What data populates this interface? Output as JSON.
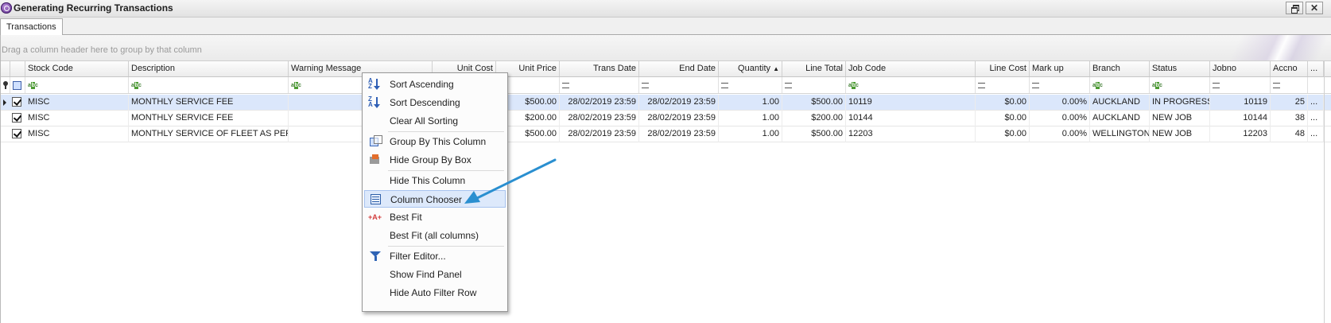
{
  "window": {
    "title": "Generating Recurring Transactions",
    "close_glyph": "✕"
  },
  "tabs": [
    {
      "label": "Transactions"
    }
  ],
  "grid": {
    "group_hint": "Drag a column header here to group by that column",
    "columns": [
      {
        "label": "Stock Code"
      },
      {
        "label": "Description"
      },
      {
        "label": "Warning Message"
      },
      {
        "label": "Unit Cost"
      },
      {
        "label": "Unit Price"
      },
      {
        "label": "Trans Date"
      },
      {
        "label": "End Date"
      },
      {
        "label": "Quantity",
        "sort": "ascending",
        "sort_glyph": "▲"
      },
      {
        "label": "Line Total"
      },
      {
        "label": "Job Code"
      },
      {
        "label": "Line Cost"
      },
      {
        "label": "Mark up"
      },
      {
        "label": "Branch"
      },
      {
        "label": "Status"
      },
      {
        "label": "Jobno"
      },
      {
        "label": "Accno"
      },
      {
        "label": "..."
      }
    ],
    "rows": [
      {
        "checked": true,
        "selected": true,
        "stock_code": "MISC",
        "description": "MONTHLY SERVICE FEE",
        "warning": "",
        "unit_cost": "",
        "unit_price": "$500.00",
        "trans_date": "28/02/2019 23:59",
        "end_date": "28/02/2019 23:59",
        "quantity": "1.00",
        "line_total": "$500.00",
        "job_code": "10119",
        "line_cost": "$0.00",
        "markup": "0.00%",
        "branch": "AUCKLAND",
        "status": "IN PROGRESS",
        "jobno": "10119",
        "accno": "25",
        "more": "..."
      },
      {
        "checked": true,
        "selected": false,
        "stock_code": "MISC",
        "description": "MONTHLY SERVICE FEE",
        "warning": "",
        "unit_cost": "",
        "unit_price": "$200.00",
        "trans_date": "28/02/2019 23:59",
        "end_date": "28/02/2019 23:59",
        "quantity": "1.00",
        "line_total": "$200.00",
        "job_code": "10144",
        "line_cost": "$0.00",
        "markup": "0.00%",
        "branch": "AUCKLAND",
        "status": "NEW JOB",
        "jobno": "10144",
        "accno": "38",
        "more": "..."
      },
      {
        "checked": true,
        "selected": false,
        "stock_code": "MISC",
        "description": "MONTHLY SERVICE OF FLEET AS PER...",
        "warning": "",
        "unit_cost": "",
        "unit_price": "$500.00",
        "trans_date": "28/02/2019 23:59",
        "end_date": "28/02/2019 23:59",
        "quantity": "1.00",
        "line_total": "$500.00",
        "job_code": "12203",
        "line_cost": "$0.00",
        "markup": "0.00%",
        "branch": "WELLINGTON",
        "status": "NEW JOB",
        "jobno": "12203",
        "accno": "48",
        "more": "..."
      }
    ]
  },
  "context_menu": {
    "highlighted": "Column Chooser",
    "items": [
      {
        "label": "Sort Ascending",
        "icon": "sort-ascending-icon"
      },
      {
        "label": "Sort Descending",
        "icon": "sort-descending-icon"
      },
      {
        "label": "Clear All Sorting",
        "icon": ""
      },
      {
        "label": "Group By This Column",
        "icon": "group-by-icon"
      },
      {
        "label": "Hide Group By Box",
        "icon": "hide-group-box-icon"
      },
      {
        "label": "Hide This Column",
        "icon": ""
      },
      {
        "label": "Column Chooser",
        "icon": "column-chooser-icon"
      },
      {
        "label": "Best Fit",
        "icon": "best-fit-icon"
      },
      {
        "label": "Best Fit (all columns)",
        "icon": ""
      },
      {
        "label": "Filter Editor...",
        "icon": "filter-icon"
      },
      {
        "label": "Show Find Panel",
        "icon": ""
      },
      {
        "label": "Hide Auto Filter Row",
        "icon": ""
      }
    ]
  },
  "colors": {
    "selected_row": "#dbe7fb",
    "menu_highlight": "#dde9fb",
    "annotation_arrow": "#2a8fd0"
  }
}
